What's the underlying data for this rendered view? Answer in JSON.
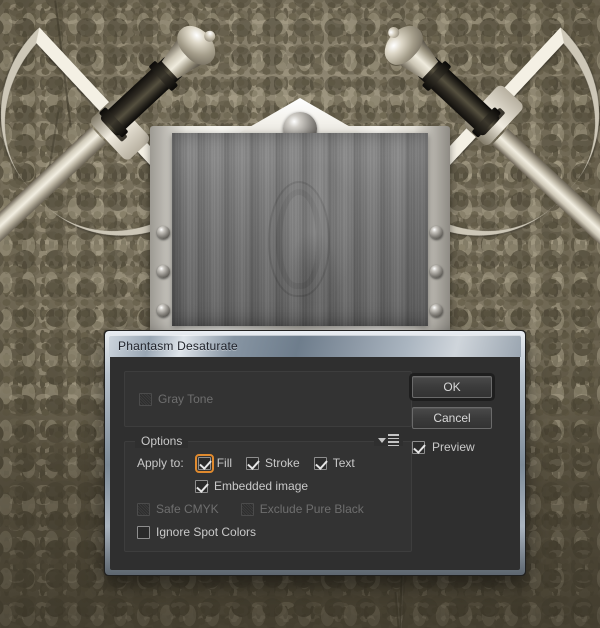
{
  "background": {
    "scene_name": "stone-wall-with-crossed-swords-and-shield",
    "wall_color": "#8c8470",
    "wall_dark_color": "#4e4838",
    "sword_blade_color": "#f2eee1",
    "sword_grip_color": "#2e2a22",
    "shield_plate_color": "#f7f6f1",
    "wood_panel_color": "#7c7c7c"
  },
  "dialog": {
    "title": "Phantasm Desaturate",
    "gray_tone": {
      "label": "Gray Tone",
      "checked": false,
      "disabled": true
    },
    "options": {
      "legend": "Options",
      "flyout_icon": "flyout-menu-icon",
      "apply_to_label": "Apply to:",
      "apply_to": [
        {
          "label": "Fill",
          "checked": true,
          "disabled": false,
          "focused": true
        },
        {
          "label": "Stroke",
          "checked": true,
          "disabled": false,
          "focused": false
        },
        {
          "label": "Text",
          "checked": true,
          "disabled": false,
          "focused": false
        }
      ],
      "embedded_image": {
        "label": "Embedded image",
        "checked": true,
        "disabled": false
      },
      "safe_cmyk": {
        "label": "Safe CMYK",
        "checked": false,
        "disabled": true
      },
      "exclude_pure_black": {
        "label": "Exclude Pure Black",
        "checked": false,
        "disabled": true
      },
      "ignore_spot_colors": {
        "label": "Ignore Spot Colors",
        "checked": false,
        "disabled": false
      }
    },
    "buttons": {
      "ok": "OK",
      "cancel": "Cancel"
    },
    "preview": {
      "label": "Preview",
      "checked": true
    },
    "colors": {
      "panel_bg": "#2f2f2f",
      "inset_bg": "#333333",
      "text": "#c9c9c9",
      "text_disabled": "#6e6e6e",
      "focus_accent": "#e08a2e",
      "titlebar_text": "#20232b"
    }
  }
}
